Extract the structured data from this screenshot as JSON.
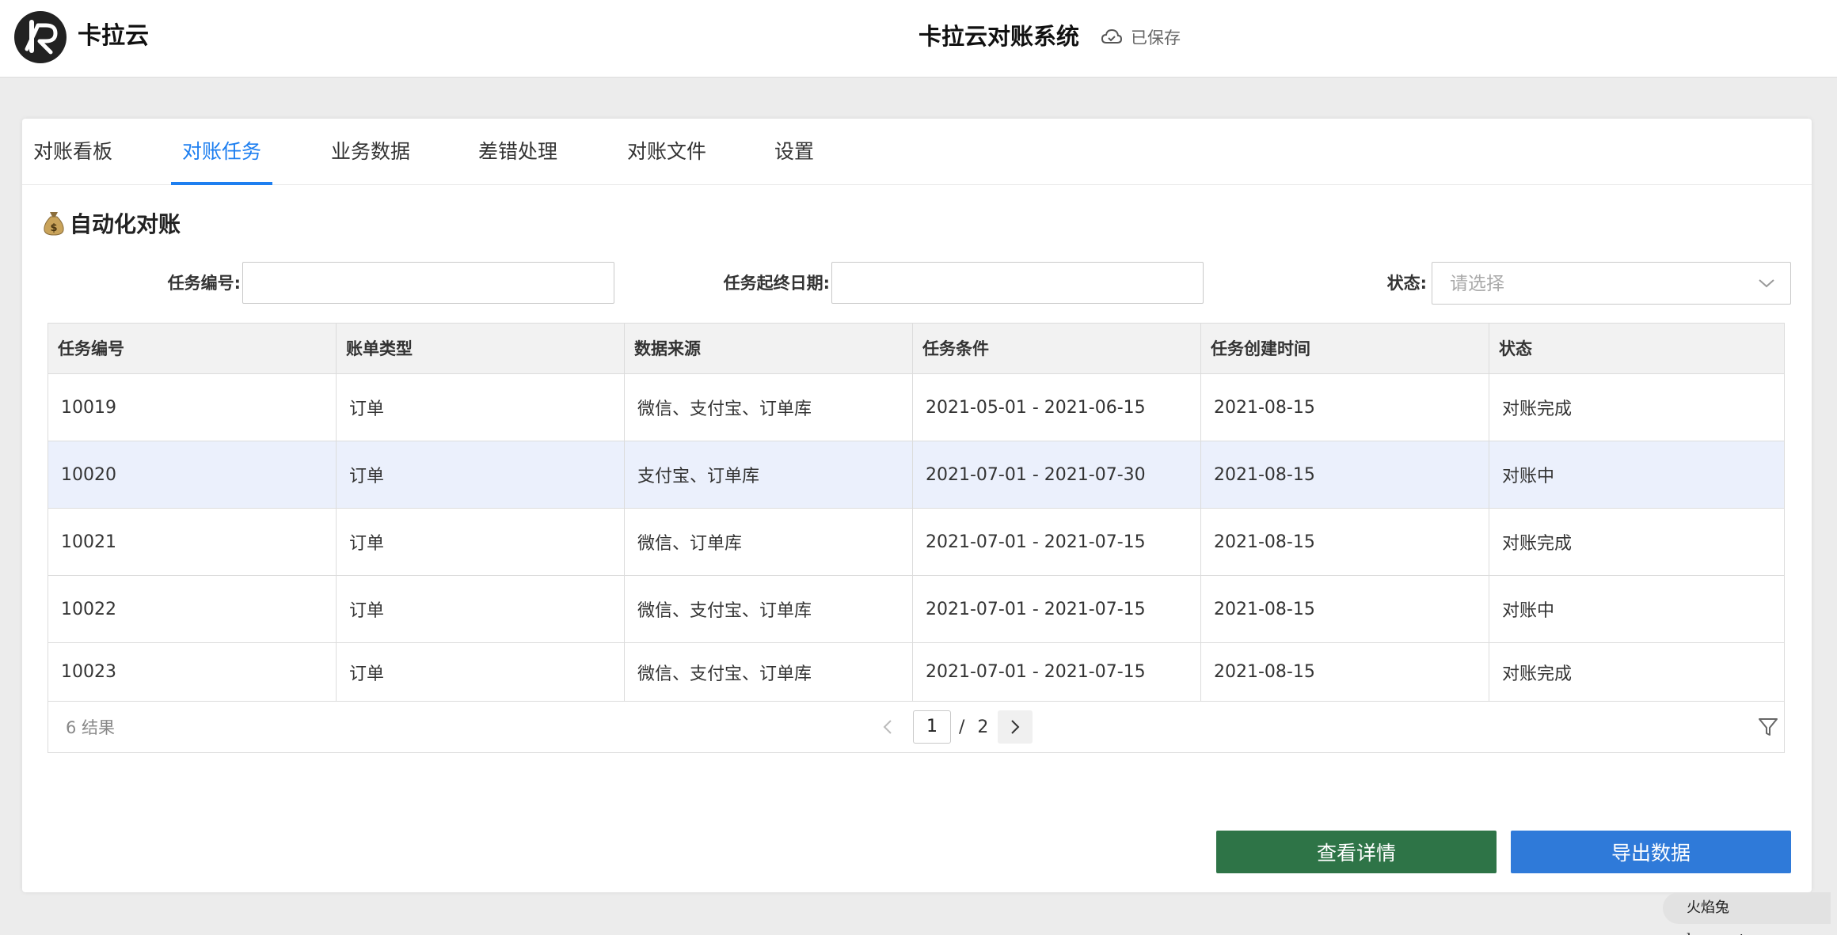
{
  "header": {
    "brand_name": "卡拉云",
    "system_title": "卡拉云对账系统",
    "save_status": "已保存"
  },
  "tabs": [
    {
      "label": "对账看板",
      "active": false
    },
    {
      "label": "对账任务",
      "active": true
    },
    {
      "label": "业务数据",
      "active": false
    },
    {
      "label": "差错处理",
      "active": false
    },
    {
      "label": "对账文件",
      "active": false
    },
    {
      "label": "设置",
      "active": false
    }
  ],
  "section": {
    "title": "自动化对账",
    "icon": "money-bag-icon"
  },
  "filters": {
    "task_id_label": "任务编号:",
    "task_id_value": "",
    "date_label": "任务起终日期:",
    "date_value": "",
    "status_label": "状态:",
    "status_placeholder": "请选择"
  },
  "table": {
    "columns": [
      "任务编号",
      "账单类型",
      "数据来源",
      "任务条件",
      "任务创建时间",
      "状态"
    ],
    "rows": [
      [
        "10019",
        "订单",
        "微信、支付宝、订单库",
        "2021-05-01 - 2021-06-15",
        "2021-08-15",
        "对账完成"
      ],
      [
        "10020",
        "订单",
        "支付宝、订单库",
        "2021-07-01 - 2021-07-30",
        "2021-08-15",
        "对账中"
      ],
      [
        "10021",
        "订单",
        "微信、订单库",
        "2021-07-01 - 2021-07-15",
        "2021-08-15",
        "对账完成"
      ],
      [
        "10022",
        "订单",
        "微信、支付宝、订单库",
        "2021-07-01 - 2021-07-15",
        "2021-08-15",
        "对账中"
      ],
      [
        "10023",
        "订单",
        "微信、支付宝、订单库",
        "2021-07-01 - 2021-07-15",
        "2021-08-15",
        "对账完成"
      ]
    ],
    "selected_row": 1,
    "result_count": "6 结果",
    "pagination": {
      "current": "1",
      "separator": "/",
      "total": "2"
    }
  },
  "buttons": {
    "detail_label": "查看详情",
    "export_label": "导出数据"
  },
  "colors": {
    "accent": "#1e7ff0",
    "detail_button": "#2e7447",
    "export_button": "#2f7ad9",
    "row_highlight": "#ebf0fc"
  },
  "watermark": "火焰兔 huoyantu.com"
}
